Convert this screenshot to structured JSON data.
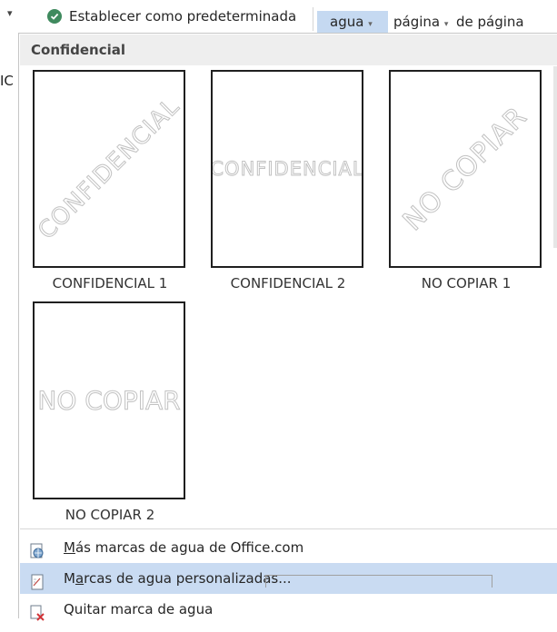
{
  "ribbon": {
    "set_default_label": "Establecer como predeterminada",
    "watermark_button": "agua",
    "page_color_button": "página",
    "page_borders_button": "de página",
    "partial_text": "IC"
  },
  "gallery": {
    "section_title": "Confidencial",
    "items": [
      {
        "caption": "CONFIDENCIAL 1",
        "watermark": "CONFIDENCIAL",
        "orientation": "diagonal"
      },
      {
        "caption": "CONFIDENCIAL 2",
        "watermark": "CONFIDENCIAL",
        "orientation": "horizontal"
      },
      {
        "caption": "NO COPIAR 1",
        "watermark": "NO COPIAR",
        "orientation": "diagonal"
      },
      {
        "caption": "NO COPIAR 2",
        "watermark": "NO COPIAR",
        "orientation": "horizontal"
      }
    ]
  },
  "menu": {
    "items": [
      {
        "label": "Más marcas de agua de Office.com",
        "accel": "M",
        "icon": "office-watermark-icon"
      },
      {
        "label": "Marcas de agua personalizadas...",
        "accel": "a",
        "icon": "custom-watermark-icon",
        "highlighted": true
      },
      {
        "label": "Quitar marca de agua",
        "accel": "",
        "icon": "remove-watermark-icon"
      }
    ]
  },
  "colors": {
    "highlight": "#c9dbf2",
    "ribbon_selected": "#c5d9f1",
    "section_header_bg": "#eeeeee",
    "check_green": "#3f8a5e"
  }
}
